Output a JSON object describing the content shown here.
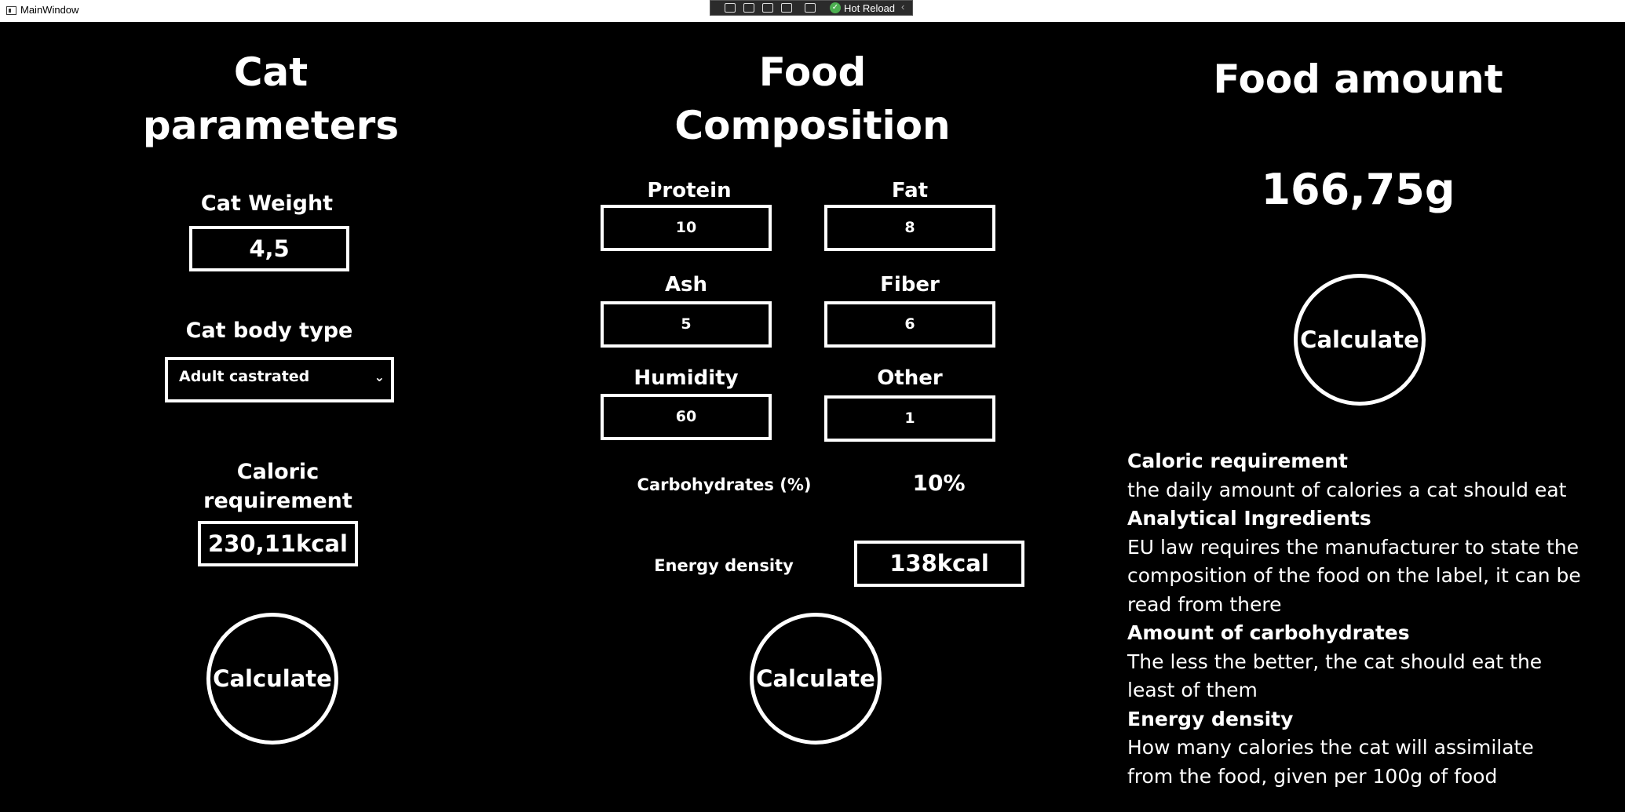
{
  "window": {
    "title": "MainWindow",
    "hot_reload_label": "Hot Reload"
  },
  "cat": {
    "heading_line1": "Cat",
    "heading_line2": "parameters",
    "weight_label": "Cat Weight",
    "weight_value": "4,5",
    "body_type_label": "Cat body type",
    "body_type_selected": "Adult castrated",
    "caloric_label_line1": "Caloric",
    "caloric_label_line2": "requirement",
    "caloric_value": "230,11kcal",
    "calculate_label": "Calculate"
  },
  "food": {
    "heading_line1": "Food",
    "heading_line2": "Composition",
    "protein_label": "Protein",
    "protein_value": "10",
    "fat_label": "Fat",
    "fat_value": "8",
    "ash_label": "Ash",
    "ash_value": "5",
    "fiber_label": "Fiber",
    "fiber_value": "6",
    "humidity_label": "Humidity",
    "humidity_value": "60",
    "other_label": "Other",
    "other_value": "1",
    "carbs_label": "Carbohydrates (%)",
    "carbs_value": "10%",
    "energy_label": "Energy density",
    "energy_value": "138kcal",
    "calculate_label": "Calculate"
  },
  "amount": {
    "heading": "Food amount",
    "value": "166,75g",
    "calculate_label": "Calculate"
  },
  "info": [
    {
      "title": "Caloric requirement",
      "text": "the daily amount of calories a cat should eat"
    },
    {
      "title": "Analytical Ingredients",
      "text": "EU law requires the manufacturer to state the composition of the food on the label, it can be read from there"
    },
    {
      "title": "Amount of carbohydrates",
      "text": "The less the better, the cat should eat the least of them"
    },
    {
      "title": "Energy density",
      "text": "How many calories the cat will assimilate from the food, given per 100g of food"
    }
  ]
}
